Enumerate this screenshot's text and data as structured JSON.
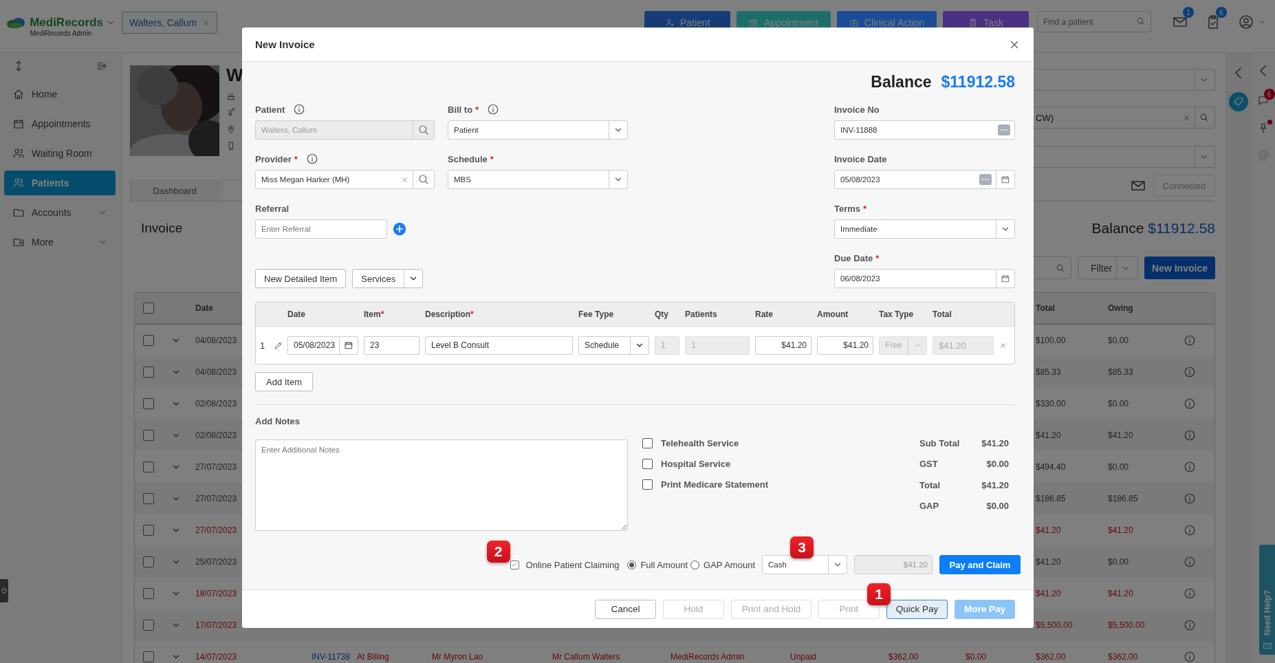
{
  "topbar": {
    "brand": "MediRecords",
    "brand_subtitle": "MediRecords Admin",
    "patient_tab": "Walters, Callum",
    "actions": [
      {
        "label": "Patient",
        "color": "#163c78"
      },
      {
        "label": "Appointment",
        "color": "#1d6e6a"
      },
      {
        "label": "Clinical Action",
        "color": "#1b4c96"
      },
      {
        "label": "Task",
        "color": "#4a3183"
      }
    ],
    "search": {
      "placeholder": "Find a patient"
    },
    "mail_badge": "1",
    "tasks_badge": "6"
  },
  "sidebar": {
    "items": [
      {
        "label": "Home",
        "selected": false,
        "expandable": false
      },
      {
        "label": "Appointments",
        "selected": false,
        "expandable": false
      },
      {
        "label": "Waiting Room",
        "selected": false,
        "expandable": false
      },
      {
        "label": "Patients",
        "selected": true,
        "expandable": false
      },
      {
        "label": "Accounts",
        "selected": false,
        "expandable": true
      },
      {
        "label": "More",
        "selected": false,
        "expandable": true
      }
    ]
  },
  "patient_header": {
    "name": "W",
    "tabs": [
      "Dashboard"
    ],
    "fields": [
      {
        "kind": "select"
      },
      {
        "kind": "search",
        "value": "CW)"
      },
      {
        "kind": "select"
      }
    ],
    "connection": "Connected"
  },
  "invoices": {
    "title": "Invoice",
    "balance_label": "Balance",
    "balance": "$11912.58",
    "filter": "Filter",
    "new_button": "New Invoice",
    "select_all_checked": false,
    "columns": {
      "date": "Date",
      "total": "Total",
      "owing": "Owing"
    },
    "rows": [
      {
        "checked": false,
        "date": "04/08/2023",
        "overdue": false,
        "total": "$100.00",
        "owing": "$0.00"
      },
      {
        "checked": false,
        "date": "04/08/2023",
        "overdue": false,
        "total": "$85.33",
        "owing": "$85.33"
      },
      {
        "checked": false,
        "date": "02/08/2023",
        "overdue": false,
        "total": "$330.00",
        "owing": "$0.00"
      },
      {
        "checked": false,
        "date": "02/08/2023",
        "overdue": false,
        "total": "$41.20",
        "owing": "$41.20"
      },
      {
        "checked": false,
        "date": "27/07/2023",
        "overdue": false,
        "total": "$494.40",
        "owing": "$0.00"
      },
      {
        "checked": false,
        "date": "27/07/2023",
        "overdue": false,
        "total": "$186.85",
        "owing": "$186.85"
      },
      {
        "checked": false,
        "date": "27/07/2023",
        "overdue": true,
        "total": "$41.20",
        "owing": "$41.20"
      },
      {
        "checked": false,
        "date": "25/07/2023",
        "overdue": false,
        "total": "$41.20",
        "owing": "$0.00"
      },
      {
        "checked": false,
        "date": "18/07/2023",
        "overdue": true,
        "total": "$41.20",
        "owing": "$41.20"
      },
      {
        "checked": false,
        "date": "17/07/2023",
        "overdue": true,
        "total": "$5,500.00",
        "owing": "$5,500.00"
      },
      {
        "checked": false,
        "date": "14/07/2023",
        "overdue": true,
        "number": "INV-11738",
        "stage": "At Billing",
        "provider": "Mr Myron Lao",
        "patient": "Mr Callum Walters",
        "created_by": "MediRecords Admin",
        "status": "Unpaid",
        "column_9": "$362.00",
        "column_10": "$0.00",
        "total": "$362.00",
        "owing": "$362.00"
      }
    ]
  },
  "rail": {
    "chat_badge": "6",
    "help": "Need Help?"
  },
  "dialog": {
    "title": "New Invoice",
    "balance_label": "Balance",
    "balance": "$11912.58",
    "fields": [
      {
        "label": "Patient",
        "info": true,
        "kind": "search",
        "value": "Walters, Callum",
        "disabled": true
      },
      {
        "label": "Bill to",
        "required_mark": "*",
        "info": true,
        "kind": "select",
        "value": "Patient",
        "disabled": false
      },
      {
        "label": "Invoice No",
        "kind": "plain",
        "value": "INV-11888",
        "disabled": false,
        "more_button": true
      },
      {
        "label": "Provider",
        "required_mark": "*",
        "info": true,
        "kind": "search",
        "value": "Miss Megan Harker (MH)",
        "disabled": false,
        "clearable": true
      },
      {
        "label": "Schedule",
        "required_mark": "*",
        "kind": "select",
        "value": "MBS",
        "disabled": false
      },
      {
        "label": "Invoice Date",
        "kind": "date",
        "value": "05/08/2023",
        "disabled": false,
        "more_button": true
      },
      {
        "label": "Referral",
        "kind": "text",
        "placeholder": "Enter Referral",
        "add_button": true
      },
      {
        "label": "Terms",
        "required_mark": "*",
        "kind": "select",
        "value": "Immediate",
        "disabled": false
      },
      {
        "label": "Due Date",
        "required_mark": "*",
        "kind": "date",
        "value": "06/08/2023",
        "disabled": false
      }
    ],
    "new_item_button": "New Detailed Item",
    "services_button": "Services",
    "items_columns": [
      {
        "label": "Date"
      },
      {
        "label": "Item",
        "required_mark": "*"
      },
      {
        "label": "Description",
        "required_mark": "*"
      },
      {
        "label": "Fee Type"
      },
      {
        "label": "Qty"
      },
      {
        "label": "Patients"
      },
      {
        "label": "Rate"
      },
      {
        "label": "Amount"
      },
      {
        "label": "Tax Type"
      },
      {
        "label": "Total"
      }
    ],
    "items": [
      {
        "number": "1",
        "date": "05/08/2023",
        "item": "23",
        "description": "Level B Consult",
        "fee_type": "Schedule",
        "qty": "1",
        "patients": "1",
        "rate": "$41.20",
        "amount": "$41.20",
        "tax_type": "Free",
        "total": "$41.20"
      }
    ],
    "add_item_button": "Add Item",
    "notes": {
      "label": "Add Notes",
      "placeholder": "Enter Additional Notes"
    },
    "options": [
      {
        "label": "Telehealth Service",
        "checked": false
      },
      {
        "label": "Hospital Service",
        "checked": false
      },
      {
        "label": "Print Medicare Statement",
        "checked": false
      }
    ],
    "totals": [
      {
        "label": "Sub Total",
        "value": "$41.20"
      },
      {
        "label": "GST",
        "value": "$0.00"
      },
      {
        "label": "Total",
        "value": "$41.20"
      },
      {
        "label": "GAP",
        "value": "$0.00"
      }
    ],
    "claiming": {
      "marker": "2",
      "label": "Online Patient Claiming",
      "checked": true,
      "amount_options": [
        {
          "label": "Full Amount",
          "selected": true
        },
        {
          "label": "GAP Amount",
          "selected": false
        }
      ],
      "method": "Cash",
      "method_marker": "3",
      "amount": "$41.20",
      "button": "Pay and Claim"
    },
    "footer_buttons": [
      {
        "label": "Cancel",
        "kind": "default",
        "disabled": false,
        "focused": false
      },
      {
        "label": "Hold",
        "kind": "default",
        "disabled": true,
        "focused": false
      },
      {
        "label": "Print and Hold",
        "kind": "default",
        "disabled": true,
        "focused": false
      },
      {
        "label": "Print",
        "kind": "default",
        "disabled": true,
        "focused": false
      },
      {
        "label": "Quick Pay",
        "kind": "default",
        "disabled": false,
        "focused": true,
        "marker": "1"
      },
      {
        "label": "More Pay",
        "kind": "primary",
        "disabled": true,
        "focused": false
      }
    ]
  }
}
